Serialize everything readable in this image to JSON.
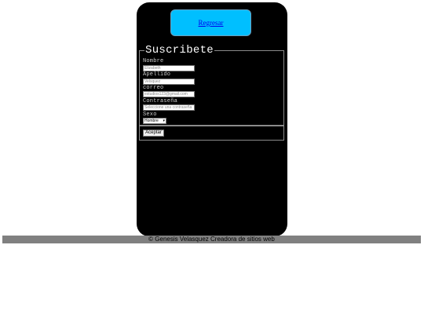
{
  "back_link": "Regresar",
  "form": {
    "legend": "Suscribete",
    "fields": [
      {
        "label": "Nombre",
        "placeholder": "Elizabeth"
      },
      {
        "label": "Apellido",
        "placeholder": "Velsquez"
      },
      {
        "label": "correo",
        "placeholder": "estudios123@gmail.com"
      },
      {
        "label": "Contraseña",
        "placeholder": "Seleccione una contraseña"
      }
    ],
    "sex_label": "Sexo",
    "sex_selected": "Hombre",
    "submit_label": "Aceptar"
  },
  "footer": "© Genesis Velasquez Creadora de sitios web",
  "colors": {
    "card": "#000000",
    "button": "#00bfff",
    "footer": "#808080"
  }
}
